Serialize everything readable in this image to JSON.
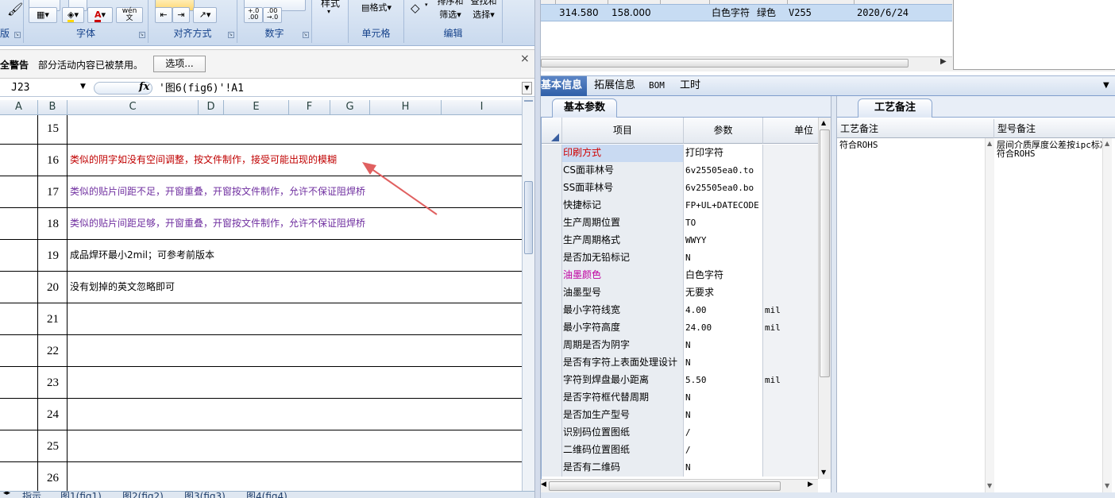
{
  "ribbon": {
    "groups": [
      {
        "label": "版"
      },
      {
        "label": "字体"
      },
      {
        "label": "对齐方式"
      },
      {
        "label": "数字"
      },
      {
        "label": "样式"
      },
      {
        "label": "单元格"
      },
      {
        "label": "编辑"
      }
    ],
    "cells_format_label": "格式",
    "edit_sort_label": "排序和",
    "edit_find_label": "查找和",
    "edit_filter_label": "筛选",
    "edit_select_label": "选择",
    "style_label": "样式",
    "wen_label": "wén\n文",
    "decimal_inc": "+.0\n.00",
    "decimal_dec": ".00\n→.0"
  },
  "security_bar": {
    "title": "全警告",
    "message": "部分活动内容已被禁用。",
    "options_button": "选项...",
    "close": "×"
  },
  "formula_bar": {
    "name_box": "J23",
    "fx": "fx",
    "formula": "'图6(fig6)'!A1"
  },
  "columns": [
    "A",
    "B",
    "C",
    "D",
    "E",
    "F",
    "G",
    "H",
    "I"
  ],
  "rows": [
    {
      "num": "15",
      "text": "",
      "color": ""
    },
    {
      "num": "16",
      "text": "类似的阴字如没有空间调整，按文件制作，接受可能出现的模糊",
      "color": "red"
    },
    {
      "num": "17",
      "text": "类似的贴片间距不足，开窗重叠，开窗按文件制作，允许不保证阻焊桥",
      "color": "purple"
    },
    {
      "num": "18",
      "text": "类似的贴片间距足够，开窗重叠，开窗按文件制作，允许不保证阻焊桥",
      "color": "purple"
    },
    {
      "num": "19",
      "text": "成品焊环最小2mil；可参考前版本",
      "color": ""
    },
    {
      "num": "20",
      "text": "没有划掉的英文忽略即可",
      "color": ""
    },
    {
      "num": "21",
      "text": "",
      "color": ""
    },
    {
      "num": "22",
      "text": "",
      "color": ""
    },
    {
      "num": "23",
      "text": "",
      "color": ""
    },
    {
      "num": "24",
      "text": "",
      "color": ""
    },
    {
      "num": "25",
      "text": "",
      "color": ""
    },
    {
      "num": "26",
      "text": "",
      "color": ""
    }
  ],
  "sheet_tabs": [
    "指示",
    "图1(fig1)",
    "图2(fig2)",
    "图3(fig3)",
    "图4(fig4)"
  ],
  "top_right_row": {
    "c1": "314.580",
    "c2": "158.000",
    "c3": "白色字符",
    "c4": "绿色",
    "c5": "V255",
    "c6": "2020/6/24"
  },
  "tabs": [
    "基本信息",
    "拓展信息",
    "BOM",
    "工时"
  ],
  "basic_params_tab": "基本参数",
  "table": {
    "headers": {
      "item": "项目",
      "param": "参数",
      "unit": "单位"
    },
    "rows": [
      {
        "item": "印刷方式",
        "value": "打印字符",
        "unit": "",
        "item_color": "red",
        "selected": true
      },
      {
        "item": "CS面菲林号",
        "value": "6v25505ea0.to",
        "unit": "",
        "item_color": ""
      },
      {
        "item": "SS面菲林号",
        "value": "6v25505ea0.bo",
        "unit": "",
        "item_color": ""
      },
      {
        "item": "快捷标记",
        "value": "FP+UL+DATECODE",
        "unit": "",
        "item_color": ""
      },
      {
        "item": "生产周期位置",
        "value": "TO",
        "unit": "",
        "item_color": ""
      },
      {
        "item": "生产周期格式",
        "value": "WWYY",
        "unit": "",
        "item_color": ""
      },
      {
        "item": "是否加无铅标记",
        "value": "N",
        "unit": "",
        "item_color": ""
      },
      {
        "item": "油墨颜色",
        "value": "白色字符",
        "unit": "",
        "item_color": "pink"
      },
      {
        "item": "油墨型号",
        "value": "无要求",
        "unit": "",
        "item_color": ""
      },
      {
        "item": "最小字符线宽",
        "value": "4.00",
        "unit": "mil",
        "item_color": ""
      },
      {
        "item": "最小字符高度",
        "value": "24.00",
        "unit": "mil",
        "item_color": ""
      },
      {
        "item": "周期是否为阴字",
        "value": "N",
        "unit": "",
        "item_color": ""
      },
      {
        "item": "是否有字符上表面处理设计",
        "value": "N",
        "unit": "",
        "item_color": ""
      },
      {
        "item": "字符到焊盘最小距离",
        "value": "5.50",
        "unit": "mil",
        "item_color": ""
      },
      {
        "item": "是否字符框代替周期",
        "value": "N",
        "unit": "",
        "item_color": ""
      },
      {
        "item": "是否加生产型号",
        "value": "N",
        "unit": "",
        "item_color": ""
      },
      {
        "item": "识别码位置图纸",
        "value": "/",
        "unit": "",
        "item_color": ""
      },
      {
        "item": "二维码位置图纸",
        "value": "/",
        "unit": "",
        "item_color": ""
      },
      {
        "item": "是否有二维码",
        "value": "N",
        "unit": "",
        "item_color": ""
      }
    ]
  },
  "process_notes": {
    "tab": "工艺备注",
    "col1_header": "工艺备注",
    "col2_header": "型号备注",
    "col1_value": "符合ROHS",
    "col2_value": "层间介质厚度公差按ipc标准  符合ROHS"
  },
  "colors": {
    "accent": "#2f5fa8",
    "red_text": "#c00000",
    "purple_text": "#7030a0",
    "arrow": "#e06060"
  }
}
